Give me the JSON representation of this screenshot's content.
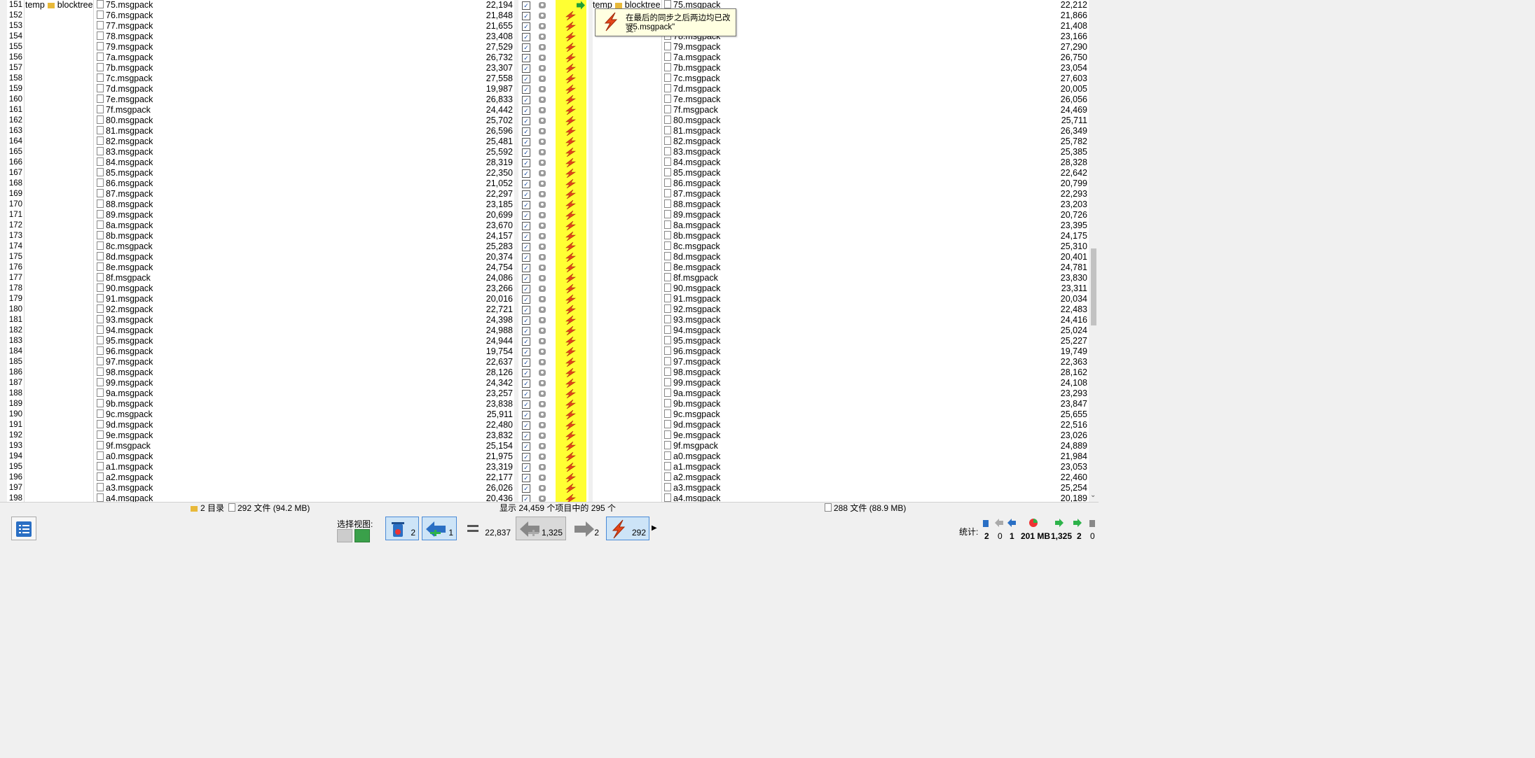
{
  "left": {
    "folder_path": [
      "temp",
      "blocktree"
    ],
    "rows": [
      {
        "n": "151",
        "name": "75.msgpack",
        "size": "22,194"
      },
      {
        "n": "152",
        "name": "76.msgpack",
        "size": "21,848"
      },
      {
        "n": "153",
        "name": "77.msgpack",
        "size": "21,655"
      },
      {
        "n": "154",
        "name": "78.msgpack",
        "size": "23,408"
      },
      {
        "n": "155",
        "name": "79.msgpack",
        "size": "27,529"
      },
      {
        "n": "156",
        "name": "7a.msgpack",
        "size": "26,732"
      },
      {
        "n": "157",
        "name": "7b.msgpack",
        "size": "23,307"
      },
      {
        "n": "158",
        "name": "7c.msgpack",
        "size": "27,558"
      },
      {
        "n": "159",
        "name": "7d.msgpack",
        "size": "19,987"
      },
      {
        "n": "160",
        "name": "7e.msgpack",
        "size": "26,833"
      },
      {
        "n": "161",
        "name": "7f.msgpack",
        "size": "24,442"
      },
      {
        "n": "162",
        "name": "80.msgpack",
        "size": "25,702"
      },
      {
        "n": "163",
        "name": "81.msgpack",
        "size": "26,596"
      },
      {
        "n": "164",
        "name": "82.msgpack",
        "size": "25,481"
      },
      {
        "n": "165",
        "name": "83.msgpack",
        "size": "25,592"
      },
      {
        "n": "166",
        "name": "84.msgpack",
        "size": "28,319"
      },
      {
        "n": "167",
        "name": "85.msgpack",
        "size": "22,350"
      },
      {
        "n": "168",
        "name": "86.msgpack",
        "size": "21,052"
      },
      {
        "n": "169",
        "name": "87.msgpack",
        "size": "22,297"
      },
      {
        "n": "170",
        "name": "88.msgpack",
        "size": "23,185"
      },
      {
        "n": "171",
        "name": "89.msgpack",
        "size": "20,699"
      },
      {
        "n": "172",
        "name": "8a.msgpack",
        "size": "23,670"
      },
      {
        "n": "173",
        "name": "8b.msgpack",
        "size": "24,157"
      },
      {
        "n": "174",
        "name": "8c.msgpack",
        "size": "25,283"
      },
      {
        "n": "175",
        "name": "8d.msgpack",
        "size": "20,374"
      },
      {
        "n": "176",
        "name": "8e.msgpack",
        "size": "24,754"
      },
      {
        "n": "177",
        "name": "8f.msgpack",
        "size": "24,086"
      },
      {
        "n": "178",
        "name": "90.msgpack",
        "size": "23,266"
      },
      {
        "n": "179",
        "name": "91.msgpack",
        "size": "20,016"
      },
      {
        "n": "180",
        "name": "92.msgpack",
        "size": "22,721"
      },
      {
        "n": "181",
        "name": "93.msgpack",
        "size": "24,398"
      },
      {
        "n": "182",
        "name": "94.msgpack",
        "size": "24,988"
      },
      {
        "n": "183",
        "name": "95.msgpack",
        "size": "24,944"
      },
      {
        "n": "184",
        "name": "96.msgpack",
        "size": "19,754"
      },
      {
        "n": "185",
        "name": "97.msgpack",
        "size": "22,637"
      },
      {
        "n": "186",
        "name": "98.msgpack",
        "size": "28,126"
      },
      {
        "n": "187",
        "name": "99.msgpack",
        "size": "24,342"
      },
      {
        "n": "188",
        "name": "9a.msgpack",
        "size": "23,257"
      },
      {
        "n": "189",
        "name": "9b.msgpack",
        "size": "23,838"
      },
      {
        "n": "190",
        "name": "9c.msgpack",
        "size": "25,911"
      },
      {
        "n": "191",
        "name": "9d.msgpack",
        "size": "22,480"
      },
      {
        "n": "192",
        "name": "9e.msgpack",
        "size": "23,832"
      },
      {
        "n": "193",
        "name": "9f.msgpack",
        "size": "25,154"
      },
      {
        "n": "194",
        "name": "a0.msgpack",
        "size": "21,975"
      },
      {
        "n": "195",
        "name": "a1.msgpack",
        "size": "23,319"
      },
      {
        "n": "196",
        "name": "a2.msgpack",
        "size": "22,177"
      },
      {
        "n": "197",
        "name": "a3.msgpack",
        "size": "26,026"
      },
      {
        "n": "198",
        "name": "a4.msgpack",
        "size": "20,436"
      }
    ]
  },
  "right": {
    "folder_path": [
      "temp",
      "blocktree"
    ],
    "rows": [
      {
        "name": "75.msgpack",
        "size": "22,212"
      },
      {
        "name": "76.msgpack",
        "size": "21,866"
      },
      {
        "name": "77.msgpack",
        "size": "21,408"
      },
      {
        "name": "78.msgpack",
        "size": "23,166"
      },
      {
        "name": "79.msgpack",
        "size": "27,290"
      },
      {
        "name": "7a.msgpack",
        "size": "26,750"
      },
      {
        "name": "7b.msgpack",
        "size": "23,054"
      },
      {
        "name": "7c.msgpack",
        "size": "27,603"
      },
      {
        "name": "7d.msgpack",
        "size": "20,005"
      },
      {
        "name": "7e.msgpack",
        "size": "26,056"
      },
      {
        "name": "7f.msgpack",
        "size": "24,469"
      },
      {
        "name": "80.msgpack",
        "size": "25,711"
      },
      {
        "name": "81.msgpack",
        "size": "26,349"
      },
      {
        "name": "82.msgpack",
        "size": "25,782"
      },
      {
        "name": "83.msgpack",
        "size": "25,385"
      },
      {
        "name": "84.msgpack",
        "size": "28,328"
      },
      {
        "name": "85.msgpack",
        "size": "22,642"
      },
      {
        "name": "86.msgpack",
        "size": "20,799"
      },
      {
        "name": "87.msgpack",
        "size": "22,293"
      },
      {
        "name": "88.msgpack",
        "size": "23,203"
      },
      {
        "name": "89.msgpack",
        "size": "20,726"
      },
      {
        "name": "8a.msgpack",
        "size": "23,395"
      },
      {
        "name": "8b.msgpack",
        "size": "24,175"
      },
      {
        "name": "8c.msgpack",
        "size": "25,310"
      },
      {
        "name": "8d.msgpack",
        "size": "20,401"
      },
      {
        "name": "8e.msgpack",
        "size": "24,781"
      },
      {
        "name": "8f.msgpack",
        "size": "23,830"
      },
      {
        "name": "90.msgpack",
        "size": "23,311"
      },
      {
        "name": "91.msgpack",
        "size": "20,034"
      },
      {
        "name": "92.msgpack",
        "size": "22,483"
      },
      {
        "name": "93.msgpack",
        "size": "24,416"
      },
      {
        "name": "94.msgpack",
        "size": "25,024"
      },
      {
        "name": "95.msgpack",
        "size": "25,227"
      },
      {
        "name": "96.msgpack",
        "size": "19,749"
      },
      {
        "name": "97.msgpack",
        "size": "22,363"
      },
      {
        "name": "98.msgpack",
        "size": "28,162"
      },
      {
        "name": "99.msgpack",
        "size": "24,108"
      },
      {
        "name": "9a.msgpack",
        "size": "23,293"
      },
      {
        "name": "9b.msgpack",
        "size": "23,847"
      },
      {
        "name": "9c.msgpack",
        "size": "25,655"
      },
      {
        "name": "9d.msgpack",
        "size": "22,516"
      },
      {
        "name": "9e.msgpack",
        "size": "23,026"
      },
      {
        "name": "9f.msgpack",
        "size": "24,889"
      },
      {
        "name": "a0.msgpack",
        "size": "21,984"
      },
      {
        "name": "a1.msgpack",
        "size": "23,053"
      },
      {
        "name": "a2.msgpack",
        "size": "22,460"
      },
      {
        "name": "a3.msgpack",
        "size": "25,254"
      },
      {
        "name": "a4.msgpack",
        "size": "20,189"
      }
    ]
  },
  "tooltip": {
    "line1": "在最后的同步之后两边均已改变.",
    "line2": "\"75.msgpack\""
  },
  "status": {
    "left_dirs": "2 目录",
    "left_files": "292 文件 (94.2 MB)",
    "center": "显示 24,459 个项目中的 295 个",
    "right_files": "288 文件 (88.9 MB)"
  },
  "toolbar": {
    "select_view_label": "选择视图:",
    "counts": {
      "delete": "2",
      "left": "1",
      "equal": "22,837",
      "new_left": "1,325",
      "right": "2",
      "conflict": "292"
    },
    "stats_label": "统计:",
    "stats": {
      "c1": "2",
      "c2": "0",
      "c3": "1",
      "size": "201 MB",
      "c5": "1,325",
      "c6": "2",
      "c7": "0"
    }
  },
  "colors": {
    "conflict_column": "#ffff33",
    "bolt": "#e4461a",
    "accent": "#4a8ad6"
  },
  "icons": [
    "file-icon",
    "folder-icon",
    "checkbox-icon",
    "category-icon",
    "lightning-icon",
    "green-arrow-icon",
    "trash-icon",
    "arrow-left-icon",
    "equals-icon",
    "arrow-right-icon",
    "list-icon",
    "pie-icon",
    "refresh-icon"
  ]
}
